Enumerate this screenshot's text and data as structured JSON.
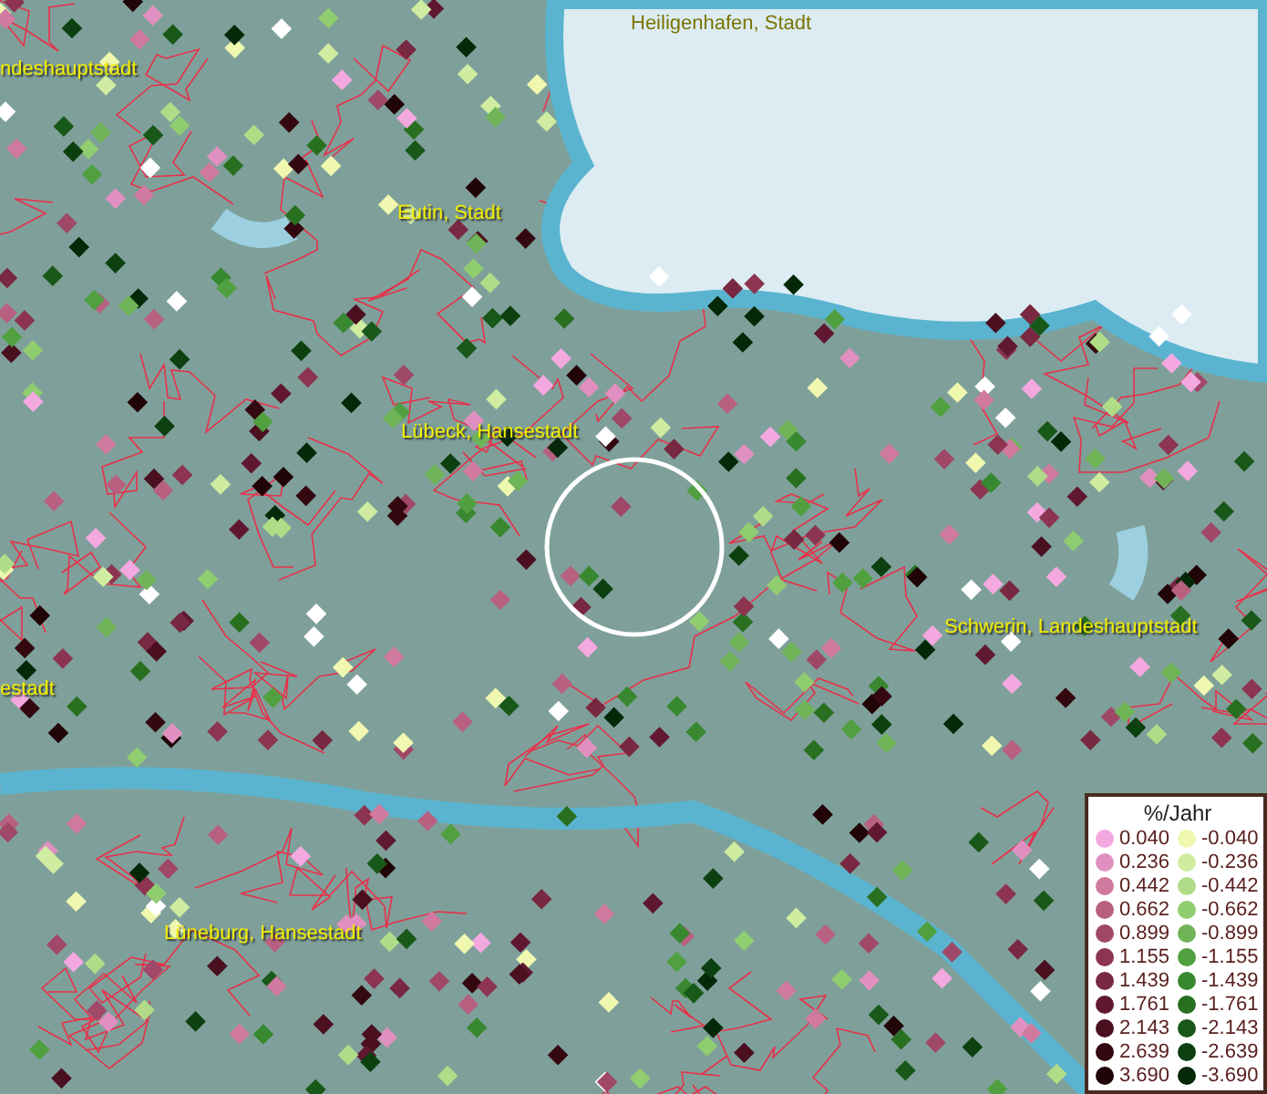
{
  "map": {
    "places": [
      {
        "name": "ndeshauptstadt"
      },
      {
        "name": "Heiligenhafen, Stadt"
      },
      {
        "name": "Eutin, Stadt"
      },
      {
        "name": "Lübeck, Hansestadt"
      },
      {
        "name": "Schwerin, Landeshauptstadt"
      },
      {
        "name": "estadt"
      },
      {
        "name": "Lüneburg, Hansestadt"
      }
    ]
  },
  "legend": {
    "title": "%/Jahr",
    "rows": [
      {
        "increase": {
          "value": "0.040",
          "color": "#f4a8e0"
        },
        "decrease": {
          "value": "-0.040",
          "color": "#f0f8b0"
        }
      },
      {
        "increase": {
          "value": "0.236",
          "color": "#e090c0"
        },
        "decrease": {
          "value": "-0.236",
          "color": "#d0eca0"
        }
      },
      {
        "increase": {
          "value": "0.442",
          "color": "#d07aa0"
        },
        "decrease": {
          "value": "-0.442",
          "color": "#b0dc88"
        }
      },
      {
        "increase": {
          "value": "0.662",
          "color": "#b86080"
        },
        "decrease": {
          "value": "-0.662",
          "color": "#90cc70"
        }
      },
      {
        "increase": {
          "value": "0.899",
          "color": "#a04868"
        },
        "decrease": {
          "value": "-0.899",
          "color": "#70b458"
        }
      },
      {
        "increase": {
          "value": "1.155",
          "color": "#8c3450"
        },
        "decrease": {
          "value": "-1.155",
          "color": "#50a040"
        }
      },
      {
        "increase": {
          "value": "1.439",
          "color": "#782840"
        },
        "decrease": {
          "value": "-1.439",
          "color": "#388830"
        }
      },
      {
        "increase": {
          "value": "1.761",
          "color": "#601830"
        },
        "decrease": {
          "value": "-1.761",
          "color": "#287020"
        }
      },
      {
        "increase": {
          "value": "2.143",
          "color": "#4a1020"
        },
        "decrease": {
          "value": "-2.143",
          "color": "#185818"
        }
      },
      {
        "increase": {
          "value": "2.639",
          "color": "#340810"
        },
        "decrease": {
          "value": "-2.639",
          "color": "#0c4010"
        }
      },
      {
        "increase": {
          "value": "3.690",
          "color": "#200408"
        },
        "decrease": {
          "value": "-3.690",
          "color": "#042808"
        }
      }
    ]
  }
}
